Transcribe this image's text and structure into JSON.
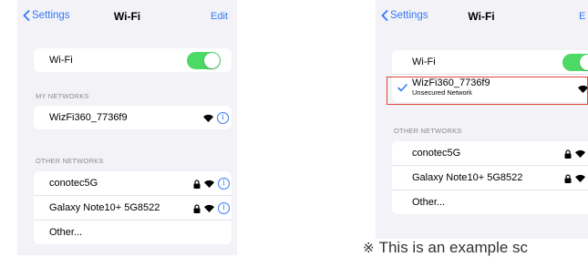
{
  "left": {
    "nav": {
      "back_label": "Settings",
      "title": "Wi-Fi",
      "edit_label": "Edit"
    },
    "wifi_toggle": {
      "label": "Wi-Fi",
      "on": true
    },
    "my_networks": {
      "header": "MY NETWORKS",
      "items": [
        {
          "name": "WizFi360_7736f9",
          "locked": false
        }
      ]
    },
    "other_networks": {
      "header": "OTHER NETWORKS",
      "items": [
        {
          "name": "conotec5G",
          "locked": true
        },
        {
          "name": "Galaxy Note10+ 5G8522",
          "locked": true
        },
        {
          "name": "Other..."
        }
      ]
    }
  },
  "right": {
    "nav": {
      "back_label": "Settings",
      "title": "Wi-Fi",
      "edit_label": "E"
    },
    "wifi_toggle": {
      "label": "Wi-Fi",
      "on": true
    },
    "connected": {
      "name": "WizFi360_7736f9",
      "subtitle": "Unsecured Network",
      "locked": false
    },
    "other_networks": {
      "header": "OTHER NETWORKS",
      "items": [
        {
          "name": "conotec5G",
          "locked": true
        },
        {
          "name": "Galaxy Note10+ 5G8522",
          "locked": true
        },
        {
          "name": "Other..."
        }
      ]
    }
  },
  "footer": {
    "mark": "※",
    "text": "This is an example sc"
  },
  "colors": {
    "accent": "#3478f6",
    "toggle_on": "#4cd964",
    "highlight": "#e0453a",
    "background": "#f2f2f7"
  }
}
